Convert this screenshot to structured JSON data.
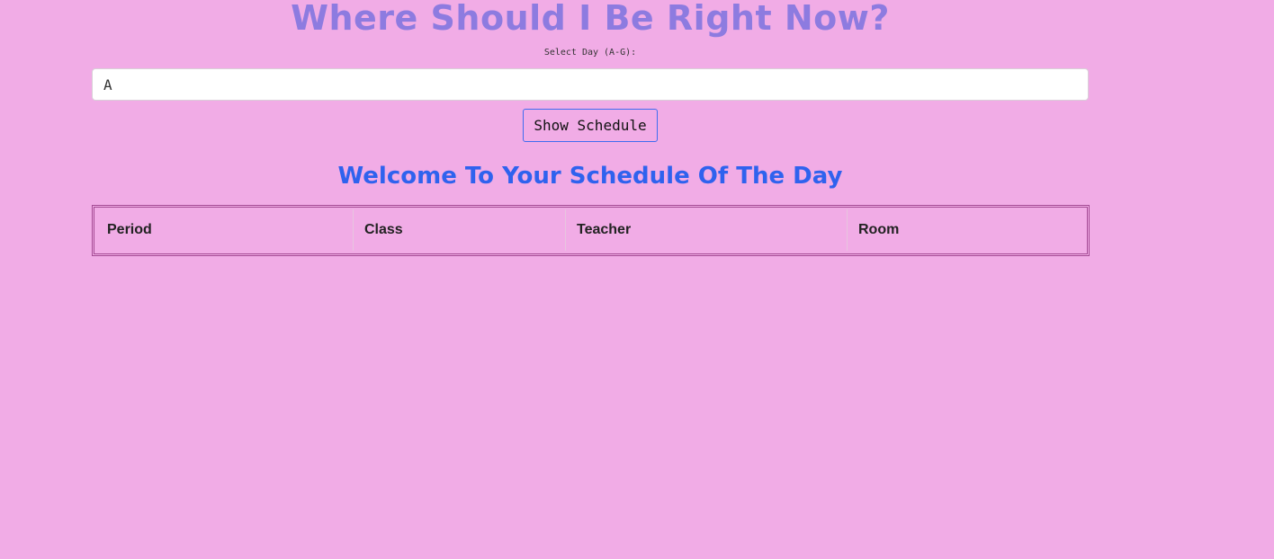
{
  "header": {
    "title": "Where Should I Be Right Now?"
  },
  "day_selector": {
    "label": "Select Day (A-G):",
    "value": "A",
    "button_label": "Show Schedule"
  },
  "schedule": {
    "heading": "Welcome To Your Schedule Of The Day",
    "columns": [
      "Period",
      "Class",
      "Teacher",
      "Room"
    ],
    "rows": []
  },
  "colors": {
    "background": "#f1ace6",
    "title": "#8d7be0",
    "subtitle": "#2f62ee",
    "button_border": "#3f6cf0",
    "table_border": "#a44a94"
  }
}
